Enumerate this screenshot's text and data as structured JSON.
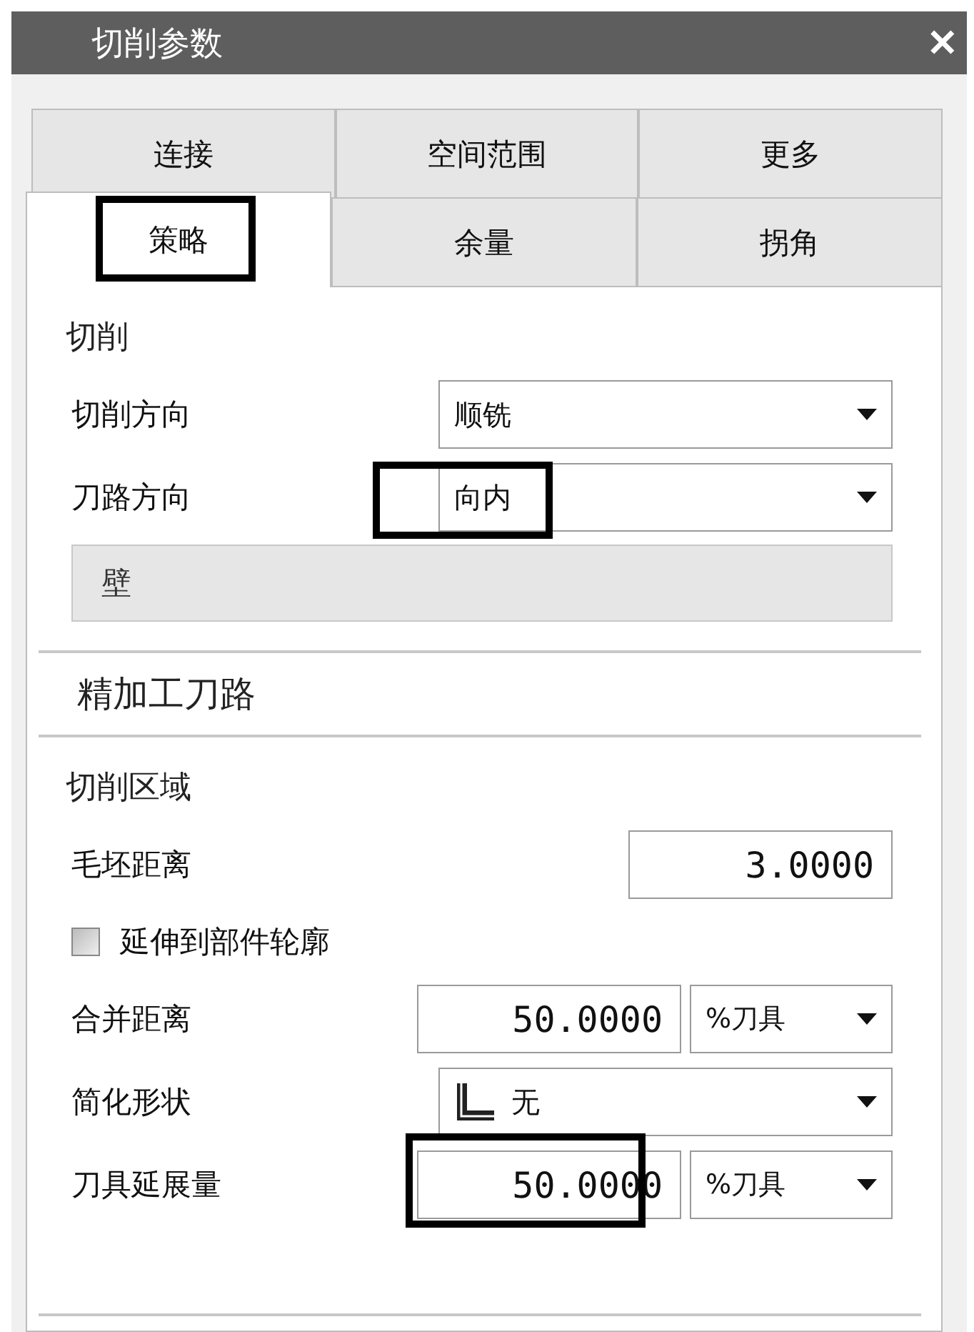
{
  "window": {
    "title": "切削参数",
    "close": "✕"
  },
  "tab_rows": [
    {
      "tabs": [
        {
          "label": "连接",
          "selected": false,
          "highlighted": false
        },
        {
          "label": "空间范围",
          "selected": false,
          "highlighted": false
        },
        {
          "label": "更多",
          "selected": false,
          "highlighted": false
        }
      ]
    },
    {
      "tabs": [
        {
          "label": "策略",
          "selected": true,
          "highlighted": true
        },
        {
          "label": "余量",
          "selected": false,
          "highlighted": false
        },
        {
          "label": "拐角",
          "selected": false,
          "highlighted": false
        }
      ]
    }
  ],
  "content": [
    {
      "kind": "group_title",
      "label": "切削"
    },
    {
      "kind": "dropdown",
      "label": "切削方向",
      "value": "顺铣",
      "highlighted": false
    },
    {
      "kind": "dropdown",
      "label": "刀路方向",
      "value": "向内",
      "highlighted": true
    },
    {
      "kind": "subgroup",
      "label": "壁"
    },
    {
      "kind": "section_title",
      "label": "精加工刀路"
    },
    {
      "kind": "group_title",
      "label": "切削区域"
    },
    {
      "kind": "number",
      "label": "毛坯距离",
      "value": "3.0000",
      "highlighted": false
    },
    {
      "kind": "checkbox",
      "label": "延伸到部件轮廓",
      "checked": false
    },
    {
      "kind": "number_unit",
      "label": "合并距离",
      "value": "50.0000",
      "unit": "%刀具",
      "highlighted": false
    },
    {
      "kind": "icon_dropdown",
      "label": "简化形状",
      "value": "无",
      "highlighted": false
    },
    {
      "kind": "number_unit",
      "label": "刀具延展量",
      "value": "50.0000",
      "unit": "%刀具",
      "highlighted": true
    }
  ]
}
